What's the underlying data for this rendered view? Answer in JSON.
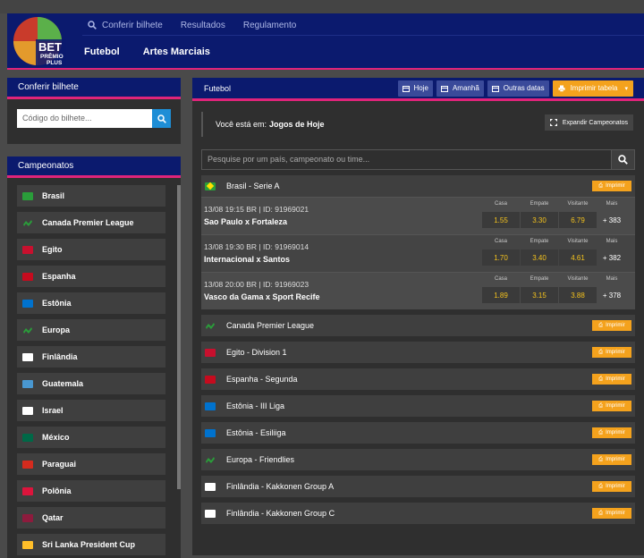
{
  "header": {
    "logo_text": "BET PRÊMIO PLUS",
    "top_links": [
      {
        "label": "Conferir bilhete"
      },
      {
        "label": "Resultados"
      },
      {
        "label": "Regulamento"
      }
    ],
    "main_links": [
      {
        "label": "Futebol"
      },
      {
        "label": "Artes Marciais"
      }
    ]
  },
  "sidebar": {
    "ticket_title": "Conferir bilhete",
    "ticket_placeholder": "Código do bilhete...",
    "championships_title": "Campeonatos",
    "items": [
      {
        "label": "Brasil",
        "flag": "#2a9d3a"
      },
      {
        "label": "Canada Premier League",
        "flag": "soccer"
      },
      {
        "label": "Egito",
        "flag": "#c8102e"
      },
      {
        "label": "Espanha",
        "flag": "#c60b1e"
      },
      {
        "label": "Estônia",
        "flag": "#0072ce"
      },
      {
        "label": "Europa",
        "flag": "soccer"
      },
      {
        "label": "Finlândia",
        "flag": "#ffffff"
      },
      {
        "label": "Guatemala",
        "flag": "#4997d0"
      },
      {
        "label": "Israel",
        "flag": "#ffffff"
      },
      {
        "label": "México",
        "flag": "#006847"
      },
      {
        "label": "Paraguai",
        "flag": "#d52b1e"
      },
      {
        "label": "Polônia",
        "flag": "#dc143c"
      },
      {
        "label": "Qatar",
        "flag": "#8d1b3d"
      },
      {
        "label": "Sri Lanka President Cup",
        "flag": "#ffbe29"
      }
    ]
  },
  "main": {
    "title": "Futebol",
    "buttons": {
      "hoje": "Hoje",
      "amanha": "Amanhã",
      "outras": "Outras datas",
      "imprimir": "Imprimir tabela"
    },
    "voce_prefix": "Você está em:",
    "voce_value": "Jogos de Hoje",
    "expand": "Expandir Campeonatos",
    "search_placeholder": "Pesquise por um país, campeonato ou time...",
    "print_label": "Imprimir",
    "brasil": {
      "name": "Brasil - Serie A",
      "odds_labels": {
        "casa": "Casa",
        "empate": "Empate",
        "visitante": "Visitante",
        "mais": "Mais"
      },
      "matches": [
        {
          "meta": "13/08 19:15 BR | ID: 91969021",
          "teams": "Sao Paulo x Fortaleza",
          "casa": "1.55",
          "empate": "3.30",
          "visitante": "6.79",
          "mais": "+ 383"
        },
        {
          "meta": "13/08 19:30 BR | ID: 91969014",
          "teams": "Internacional x Santos",
          "casa": "1.70",
          "empate": "3.40",
          "visitante": "4.61",
          "mais": "+ 382"
        },
        {
          "meta": "13/08 20:00 BR | ID: 91969023",
          "teams": "Vasco da Gama x Sport Recife",
          "casa": "1.89",
          "empate": "3.15",
          "visitante": "3.88",
          "mais": "+ 378"
        }
      ]
    },
    "championships": [
      {
        "name": "Canada Premier League",
        "flag": "soccer"
      },
      {
        "name": "Egito - Division 1",
        "flag": "#c8102e"
      },
      {
        "name": "Espanha - Segunda",
        "flag": "#c60b1e"
      },
      {
        "name": "Estônia - III Liga",
        "flag": "#0072ce"
      },
      {
        "name": "Estônia - Esiliiga",
        "flag": "#0072ce"
      },
      {
        "name": "Europa - Friendlies",
        "flag": "soccer"
      },
      {
        "name": "Finlândia - Kakkonen Group A",
        "flag": "#ffffff"
      },
      {
        "name": "Finlândia - Kakkonen Group C",
        "flag": "#ffffff"
      }
    ]
  },
  "colors": {
    "header": "#0b1a6e",
    "accent": "#e0247a",
    "orange": "#f4a21d",
    "odds": "#f4c21d"
  }
}
